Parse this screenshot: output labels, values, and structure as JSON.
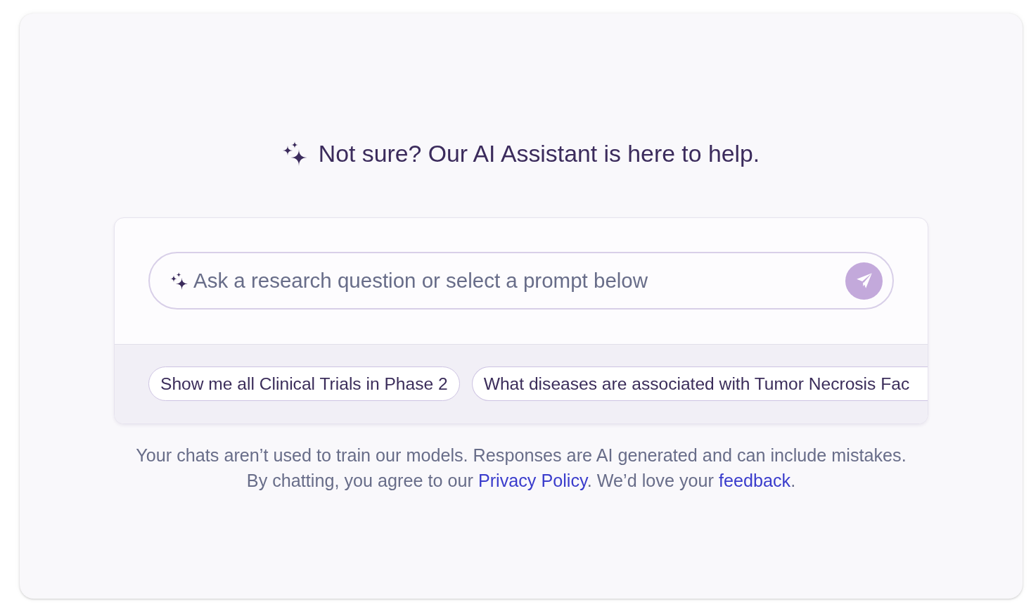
{
  "heading": {
    "text": "Not sure? Our AI Assistant is here to help."
  },
  "prompt_box": {
    "placeholder": "Ask a research question or select a prompt below"
  },
  "suggested_prompts": [
    {
      "label": "Show me all Clinical Trials in Phase 2"
    },
    {
      "label": "What diseases are associated with Tumor Necrosis Fac"
    }
  ],
  "disclaimer": {
    "notice": "Your chats aren’t used to train our models. Responses are AI generated and can include mistakes.",
    "consent": [
      {
        "kind": "text",
        "text": "By chatting, you agree to our "
      },
      {
        "kind": "link",
        "text": "Privacy Policy"
      },
      {
        "kind": "text",
        "text": ". We’d love your "
      },
      {
        "kind": "link",
        "text": "feedback"
      },
      {
        "kind": "text",
        "text": "."
      }
    ]
  }
}
